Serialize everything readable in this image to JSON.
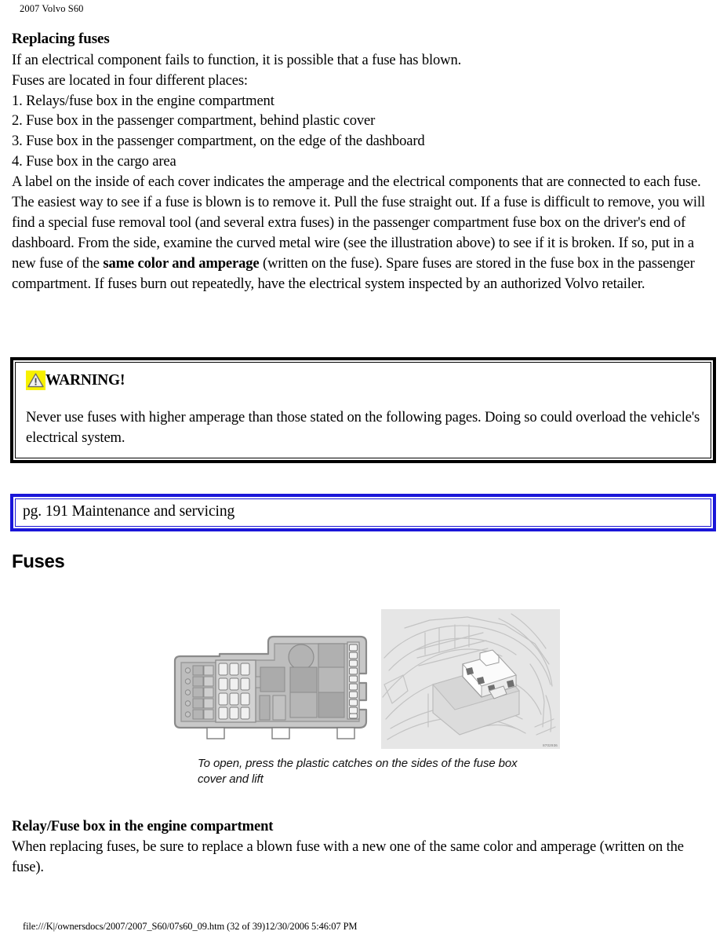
{
  "header": {
    "running_title": "2007 Volvo S60"
  },
  "main": {
    "heading": "Replacing fuses",
    "intro_line_1": "If an electrical component fails to function, it is possible that a fuse has blown.",
    "intro_line_2": "Fuses are located in four different places:",
    "locations": [
      "1. Relays/fuse box in the engine compartment",
      "2. Fuse box in the passenger compartment, behind plastic cover",
      "3. Fuse box in the passenger compartment, on the edge of the dashboard",
      "4. Fuse box in the cargo area"
    ],
    "label_note": "A label on the inside of each cover indicates the amperage and the electrical components that are connected to each fuse.",
    "removal_para_part1": "The easiest way to see if a fuse is blown is to remove it. Pull the fuse straight out. If a fuse is difficult to remove, you will find a special fuse removal tool (and several extra fuses) in the passenger compartment fuse box on the driver's end of dashboard. From the side, examine the curved metal wire (see the illustration above) to see if it is broken. If so, put in a new fuse of the ",
    "removal_para_bold": "same color and amperage",
    "removal_para_part2": " (written on the fuse). Spare fuses are stored in the fuse box in the passenger compartment. If fuses burn out repeatedly, have the electrical system inspected by an authorized Volvo retailer."
  },
  "warning": {
    "icon_name": "warning-triangle-icon",
    "icon_background": "#f7f000",
    "title": "WARNING!",
    "body": "Never use fuses with higher amperage than those stated on the following pages. Doing so could overload the vehicle's electrical system."
  },
  "page_link": {
    "text": "pg. 191 Maintenance and servicing",
    "border_color": "#1a16d8"
  },
  "fuses_section": {
    "heading": "Fuses",
    "figure_caption": "To open, press the plastic catches on the sides of the fuse box cover and lift",
    "figure_stamp": "8702936",
    "subheading": "Relay/Fuse box in the engine compartment",
    "paragraph": "When replacing fuses, be sure to replace a blown fuse with a new one of the same color and amperage (written on the fuse)."
  },
  "footer": {
    "path_text": "file:///K|/ownersdocs/2007/2007_S60/07s60_09.htm (32 of 39)12/30/2006 5:46:07 PM"
  }
}
